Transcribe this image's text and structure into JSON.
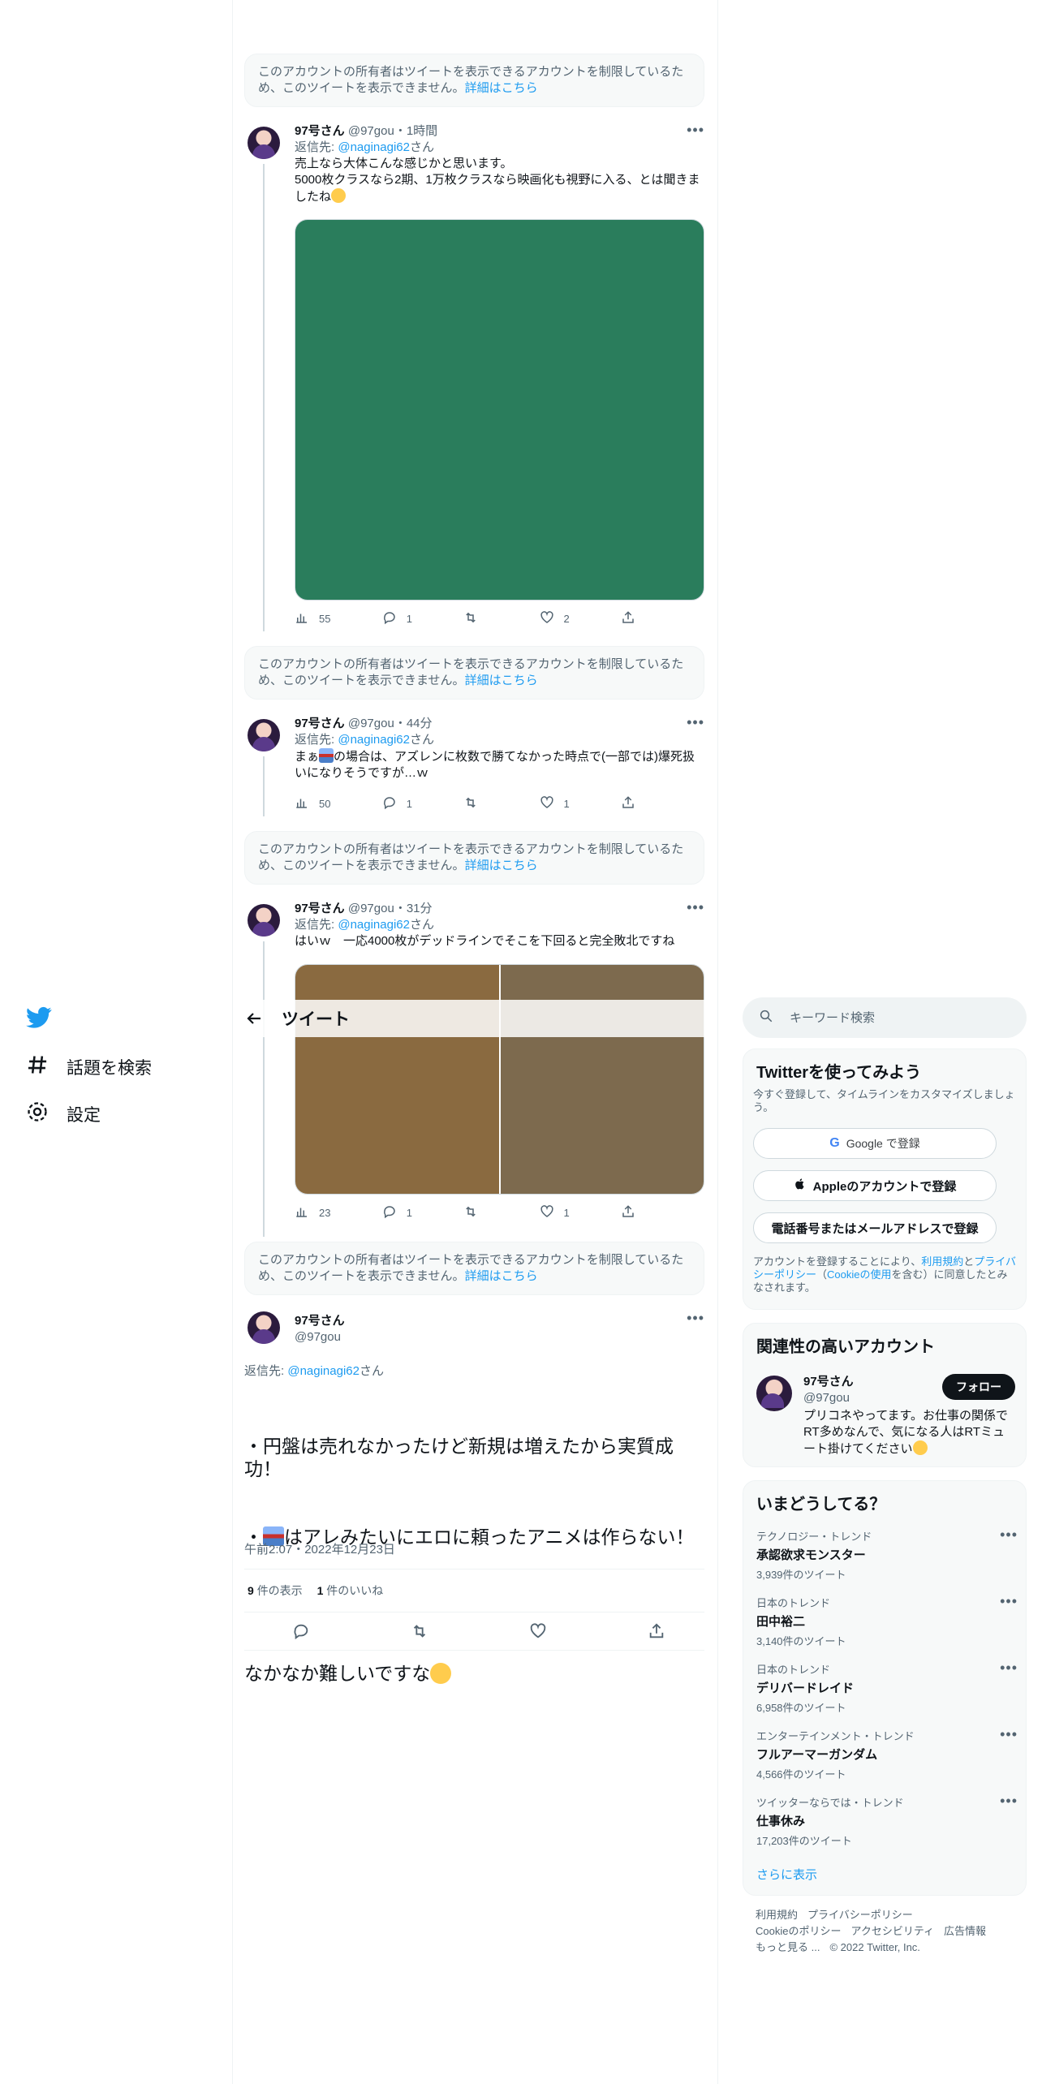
{
  "nav": {
    "explore_label": "話題を検索",
    "settings_label": "設定"
  },
  "header": {
    "title": "ツイート"
  },
  "notice": {
    "text": "このアカウントの所有者はツイートを表示できるアカウントを制限しているため、このツイートを表示できません。",
    "link": "詳細はこちら"
  },
  "tweets": [
    {
      "name": "97号さん",
      "handle": "@97gou",
      "time": "・1時間",
      "reply_prefix": "返信先:",
      "reply_to": "@naginagi62",
      "reply_suffix": "さん",
      "text": "売上なら大体こんな感じかと思います。\n5000枚クラスなら2期、1万枚クラスなら映画化も視野に入る、とは聞きましたね",
      "views": "55",
      "replies": "1",
      "retweets": "",
      "likes": "2"
    },
    {
      "name": "97号さん",
      "handle": "@97gou",
      "time": "・44分",
      "reply_prefix": "返信先:",
      "reply_to": "@naginagi62",
      "reply_suffix": "さん",
      "text_a": "まぁ",
      "text_b": "の場合は、アズレンに枚数で勝てなかった時点で(一部では)爆死扱いになりそうですが…ｗ",
      "views": "50",
      "replies": "1",
      "retweets": "",
      "likes": "1"
    },
    {
      "name": "97号さん",
      "handle": "@97gou",
      "time": "・31分",
      "reply_prefix": "返信先:",
      "reply_to": "@naginagi62",
      "reply_suffix": "さん",
      "text": "はいｗ　一応4000枚がデッドラインでそこを下回ると完全敗北ですね",
      "views": "23",
      "replies": "1",
      "retweets": "",
      "likes": "1"
    }
  ],
  "main_tweet": {
    "name": "97号さん",
    "handle": "@97gou",
    "reply_prefix": "返信先:",
    "reply_to": "@naginagi62",
    "reply_suffix": "さん",
    "line1": "・円盤は売れなかったけど新規は増えたから実質成功！",
    "line2_a": "・",
    "line2_b": "はアレみたいにエロに頼ったアニメは作らない！",
    "line3": "なかなか難しいですな",
    "timestamp": "午前2:07・2022年12月23日",
    "views_count": "9",
    "views_label": "件の表示",
    "likes_count": "1",
    "likes_label": "件のいいね"
  },
  "colors": {
    "accent": "#1d9bf0",
    "media_green": "#2a7d5c",
    "media_brown_left": "#8a6a40",
    "media_brown_right": "#7d6a4e"
  },
  "sidebar": {
    "search_placeholder": "キーワード検索",
    "signup": {
      "title": "Twitterを使ってみよう",
      "subtitle": "今すぐ登録して、タイムラインをカスタマイズしましょう。",
      "google": "Google で登録",
      "apple": "Appleのアカウントで登録",
      "phone": "電話番号またはメールアドレスで登録",
      "terms_a": "アカウントを登録することにより、",
      "terms_link1": "利用規約",
      "terms_b": "と",
      "terms_link2": "プライバシーポリシー",
      "terms_c": "（",
      "terms_link3": "Cookieの使用",
      "terms_d": "を含む）に同意したとみなされます。"
    },
    "related": {
      "title": "関連性の高いアカウント",
      "name": "97号さん",
      "handle": "@97gou",
      "bio": "プリコネやってます。お仕事の関係でRT多めなんで、気になる人はRTミュート掛けてください",
      "follow": "フォロー"
    },
    "trends": {
      "title": "いまどうしてる？",
      "items": [
        {
          "category": "テクノロジー・トレンド",
          "name": "承認欲求モンスター",
          "count": "3,939件のツイート"
        },
        {
          "category": "日本のトレンド",
          "name": "田中裕二",
          "count": "3,140件のツイート"
        },
        {
          "category": "日本のトレンド",
          "name": "デリバードレイド",
          "count": "6,958件のツイート"
        },
        {
          "category": "エンターテインメント・トレンド",
          "name": "フルアーマーガンダム",
          "count": "4,566件のツイート"
        },
        {
          "category": "ツイッターならでは・トレンド",
          "name": "仕事休み",
          "count": "17,203件のツイート"
        }
      ],
      "show_more": "さらに表示"
    },
    "footer": {
      "terms": "利用規約",
      "privacy": "プライバシーポリシー",
      "cookie": "Cookieのポリシー",
      "accessibility": "アクセシビリティ",
      "ads": "広告情報",
      "more": "もっと見る ...",
      "copyright": "© 2022 Twitter, Inc."
    }
  }
}
